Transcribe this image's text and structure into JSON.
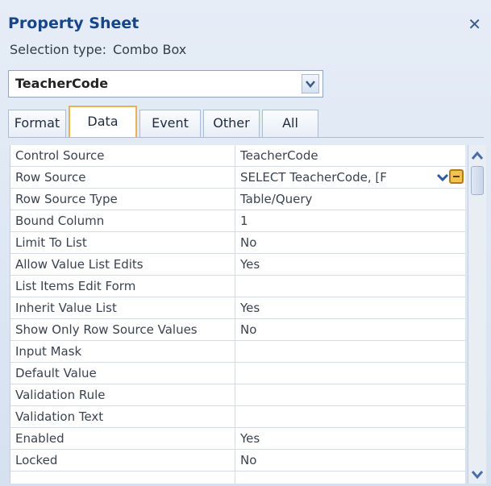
{
  "panel": {
    "title": "Property Sheet",
    "selection_type_label": "Selection type:",
    "selection_type_value": "Combo Box"
  },
  "object_combo": {
    "value": "TeacherCode"
  },
  "tabs": [
    {
      "label": "Format"
    },
    {
      "label": "Data",
      "active": true
    },
    {
      "label": "Event"
    },
    {
      "label": "Other"
    },
    {
      "label": "All"
    }
  ],
  "properties": [
    {
      "name": "Control Source",
      "value": "TeacherCode"
    },
    {
      "name": "Row Source",
      "value": "SELECT TeacherCode, [F"
    },
    {
      "name": "Row Source Type",
      "value": "Table/Query"
    },
    {
      "name": "Bound Column",
      "value": "1"
    },
    {
      "name": "Limit To List",
      "value": "No"
    },
    {
      "name": "Allow Value List Edits",
      "value": "Yes"
    },
    {
      "name": "List Items Edit Form",
      "value": ""
    },
    {
      "name": "Inherit Value List",
      "value": "Yes"
    },
    {
      "name": "Show Only Row Source Values",
      "value": "No"
    },
    {
      "name": "Input Mask",
      "value": ""
    },
    {
      "name": "Default Value",
      "value": ""
    },
    {
      "name": "Validation Rule",
      "value": ""
    },
    {
      "name": "Validation Text",
      "value": ""
    },
    {
      "name": "Enabled",
      "value": "Yes"
    },
    {
      "name": "Locked",
      "value": "No"
    }
  ],
  "icons": {
    "close": "close-icon",
    "dropdown": "chevron-down-icon",
    "builder": "builder-icon",
    "scroll_up": "scroll-up-icon",
    "scroll_down": "scroll-down-icon"
  },
  "colors": {
    "title": "#16458a",
    "active_tab_border": "#e6b35a",
    "builder_button": "#f4c34f"
  }
}
